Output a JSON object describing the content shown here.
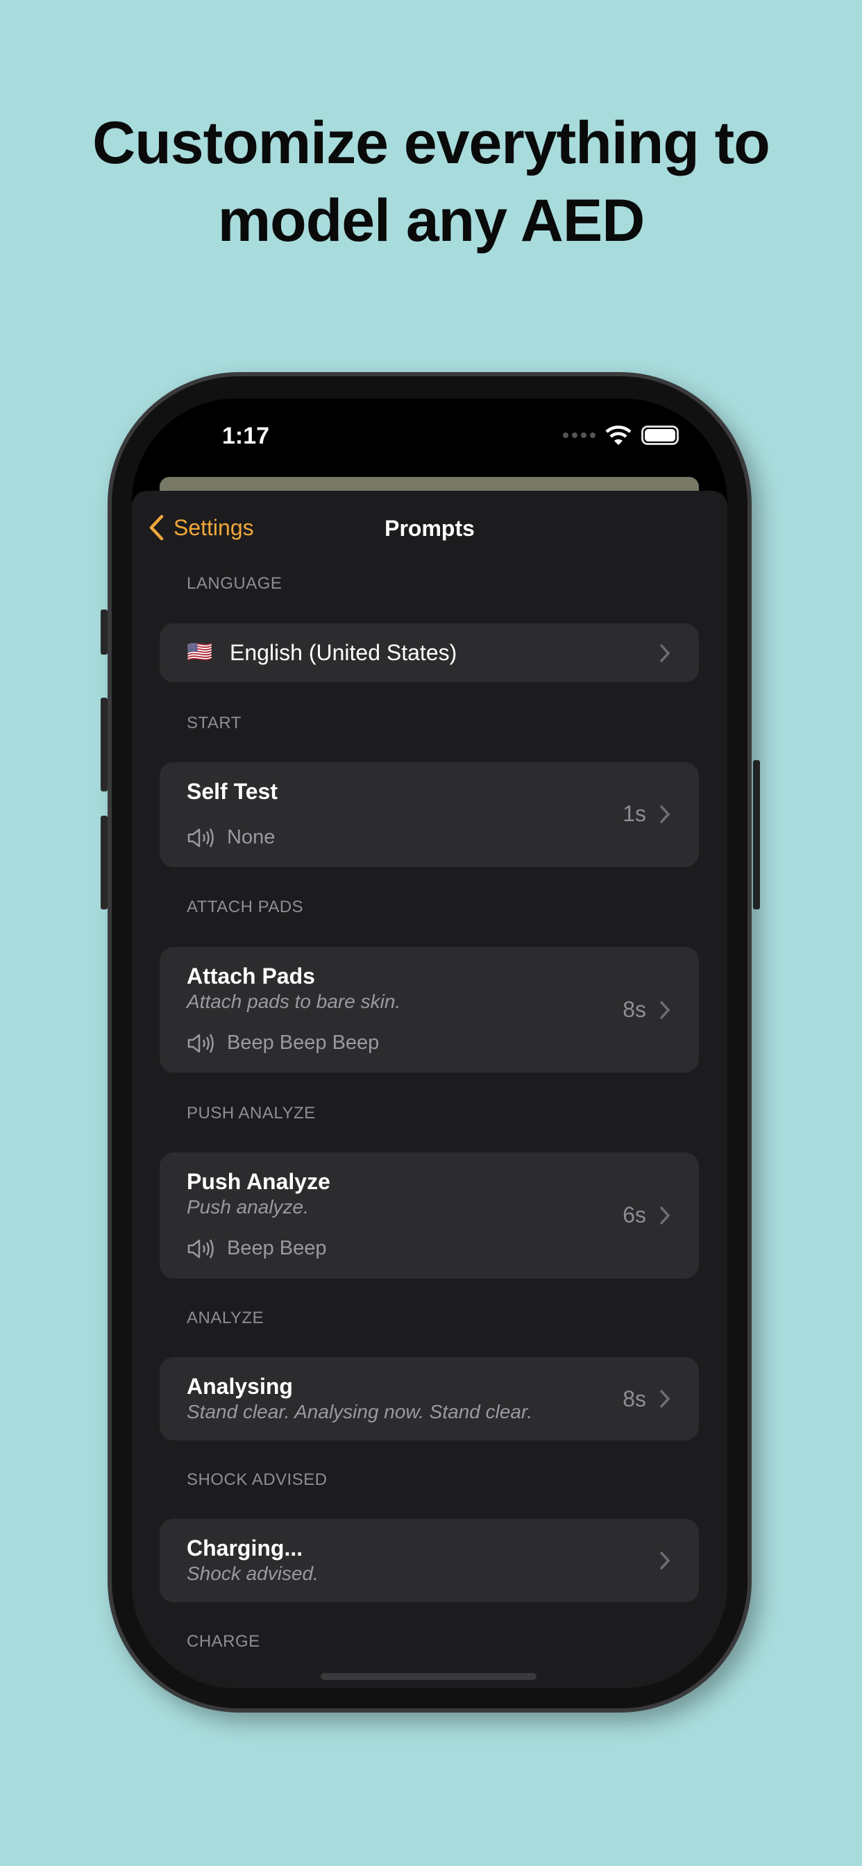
{
  "headline": [
    "Customize everything to",
    "model any AED"
  ],
  "status": {
    "time": "1:17"
  },
  "nav": {
    "back_label": "Settings",
    "title": "Prompts"
  },
  "colors": {
    "accent": "#f0a73a",
    "background": "#a8dbdc",
    "card": "#2c2c2e"
  },
  "sections": [
    {
      "header": "LANGUAGE",
      "flag": "🇺🇸",
      "value": "English (United States)"
    },
    {
      "header": "START",
      "title": "Self Test",
      "sound": "None",
      "duration": "1s"
    },
    {
      "header": "ATTACH PADS",
      "title": "Attach Pads",
      "subtitle": "Attach pads to bare skin.",
      "sound": "Beep Beep Beep",
      "duration": "8s"
    },
    {
      "header": "PUSH ANALYZE",
      "title": "Push Analyze",
      "subtitle": "Push analyze.",
      "sound": "Beep Beep",
      "duration": "6s"
    },
    {
      "header": "ANALYZE",
      "title": "Analysing",
      "subtitle": "Stand clear. Analysing now. Stand clear.",
      "duration": "8s"
    },
    {
      "header": "SHOCK ADVISED",
      "title": "Charging...",
      "subtitle": "Shock advised."
    },
    {
      "header": "CHARGE"
    }
  ]
}
